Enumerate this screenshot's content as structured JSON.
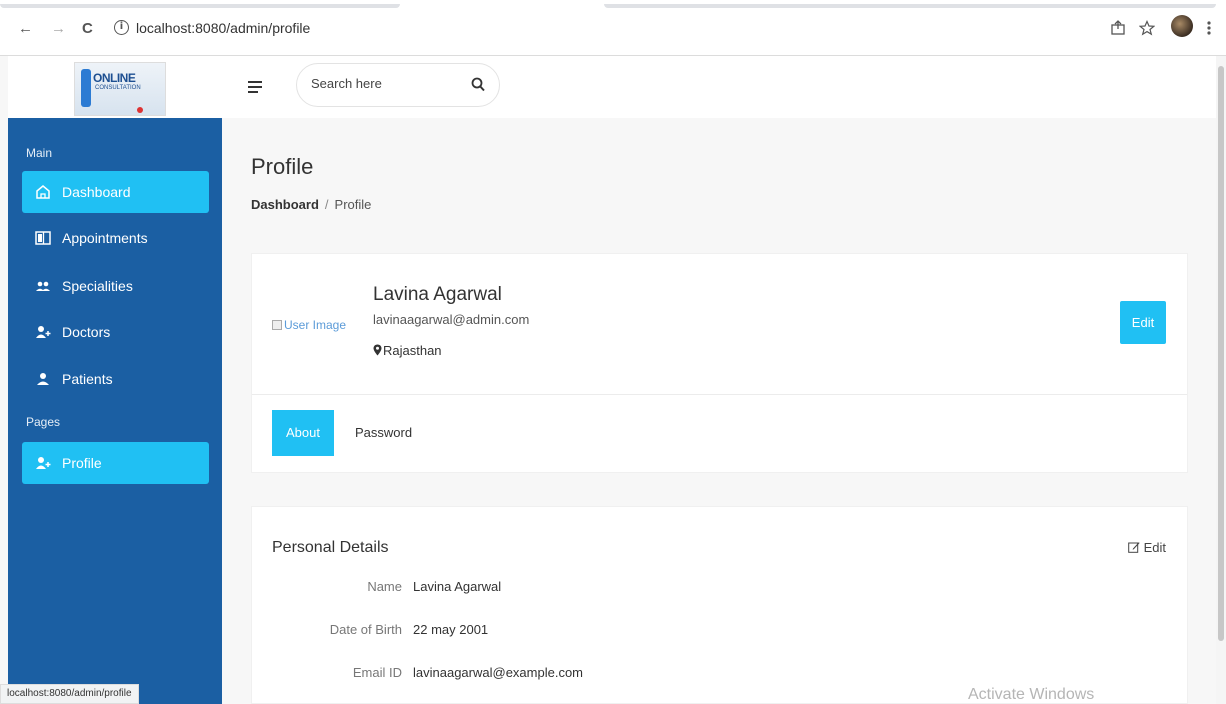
{
  "browser": {
    "url": "localhost:8080/admin/profile",
    "nav_back": "←",
    "nav_forward": "→",
    "nav_reload": "C",
    "status_url": "localhost:8080/admin/profile"
  },
  "logo": {
    "line1": "ONLINE",
    "line2": "CONSULTATION"
  },
  "header": {
    "search_placeholder": "Search here"
  },
  "sidebar": {
    "section_main": "Main",
    "section_pages": "Pages",
    "items": [
      {
        "label": "Dashboard",
        "icon": "home-icon",
        "active": true
      },
      {
        "label": "Appointments",
        "icon": "layout-icon",
        "active": false
      },
      {
        "label": "Specialities",
        "icon": "users-icon",
        "active": false
      },
      {
        "label": "Doctors",
        "icon": "user-plus-icon",
        "active": false
      },
      {
        "label": "Patients",
        "icon": "user-icon",
        "active": false
      },
      {
        "label": "Profile",
        "icon": "user-plus-icon",
        "active": true
      }
    ]
  },
  "page": {
    "title": "Profile",
    "breadcrumb": {
      "home": "Dashboard",
      "separator": "/",
      "current": "Profile"
    }
  },
  "profile": {
    "image_alt": "User Image",
    "name": "Lavina Agarwal",
    "email": "lavinaagarwal@admin.com",
    "location": "Rajasthan",
    "edit_label": "Edit",
    "tabs": [
      "About",
      "Password"
    ]
  },
  "personal": {
    "title": "Personal Details",
    "edit_label": "Edit",
    "rows": [
      {
        "key": "Name",
        "value": "Lavina Agarwal"
      },
      {
        "key": "Date of Birth",
        "value": "22 may 2001"
      },
      {
        "key": "Email ID",
        "value": "lavinaagarwal@example.com"
      }
    ]
  },
  "watermark": "Activate Windows",
  "colors": {
    "sidebar": "#1b5fa3",
    "accent": "#20c0f3"
  }
}
